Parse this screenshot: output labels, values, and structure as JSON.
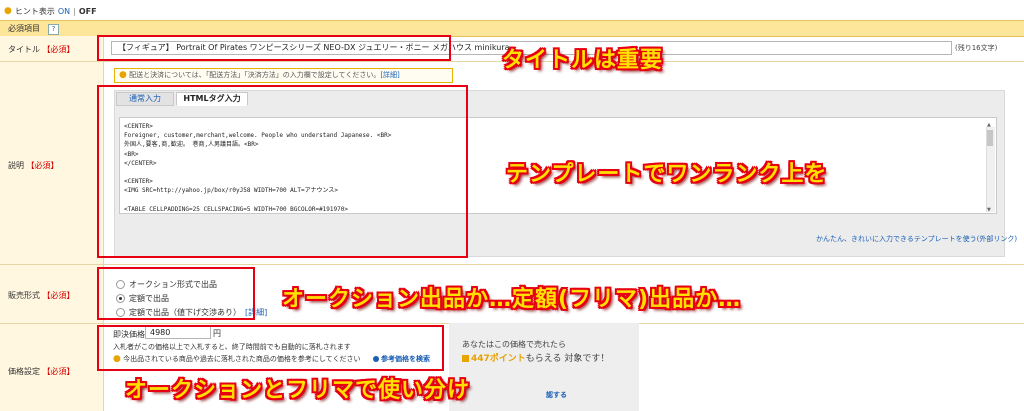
{
  "hint_bar": {
    "label": "ヒント表示",
    "on": "ON",
    "separator": "|",
    "off": "OFF"
  },
  "required_section": {
    "title": "必須項目",
    "help_icon": "?"
  },
  "labels": {
    "title": "タイトル",
    "description": "説明",
    "sale_format": "販売形式",
    "price_setting": "価格設定",
    "required_mark": "【必須】"
  },
  "title_field": {
    "value": "【フィギュア】 Portrait Of Pirates ワンピースシリーズ NEO-DX ジュエリー・ボニー メガハウス minikura",
    "char_count": "(残り16文字)"
  },
  "notice": {
    "text": "配送と決済については、「配送方法」「決済方法」の入力欄で設定してください。",
    "link": "[詳細]"
  },
  "tabs": [
    {
      "label": "通常入力",
      "active": false
    },
    {
      "label": "HTMLタグ入力",
      "active": true
    }
  ],
  "editor_lines": [
    "<CENTER>",
    "Foreigner, customer,merchant,welcome. People who understand Japanese. <BR>",
    "外国人,要客,商,歓迎。 巻商,人男議目語。<BR>",
    "<BR>",
    "</CENTER>",
    "",
    "<CENTER>",
    "<IMG SRC=http://yahoo.jp/box/r0yJ58 WIDTH=700 ALT=アナウンス>",
    "",
    "<TABLE CELLPADDING=25 CELLSPACING=5 WIDTH=700 BGCOLOR=#191970>"
  ],
  "template_link": "かんたん、きれいに入力できるテンプレートを使う(外部リンク)",
  "sale_options": [
    {
      "label": "オークション形式で出品",
      "selected": false,
      "link": ""
    },
    {
      "label": "定額で出品",
      "selected": true,
      "link": ""
    },
    {
      "label": "定額で出品（値下げ交渉あり）",
      "selected": false,
      "link": "[詳細]"
    }
  ],
  "price": {
    "label": "即決価格：",
    "value": "4980",
    "unit": "円",
    "note": "入札者がこの価格以上で入札すると、終了時間前でも自動的に落札されます",
    "tip": "今出品されている商品や過去に落札された商品の価格を参考にしてください",
    "ref_link": "参考価格を検索"
  },
  "points": {
    "line1": "あなたはこの価格で売れたら",
    "points_value": "447ポイント",
    "line2_suffix": "もらえる 対象です！",
    "confirm_link": "認する"
  },
  "annotations": {
    "title": "タイトルは重要",
    "description": "テンプレートでワンランク上を",
    "sale_format": "オークション出品か…定額(フリマ)出品か…",
    "price": "オークションとフリマで使い分け"
  },
  "colors": {
    "annotation_fill": "#ffe000",
    "annotation_outline": "#e60012",
    "header_bg": "#fde599",
    "label_bg": "#fff7e0",
    "link": "#1a5fb4"
  }
}
